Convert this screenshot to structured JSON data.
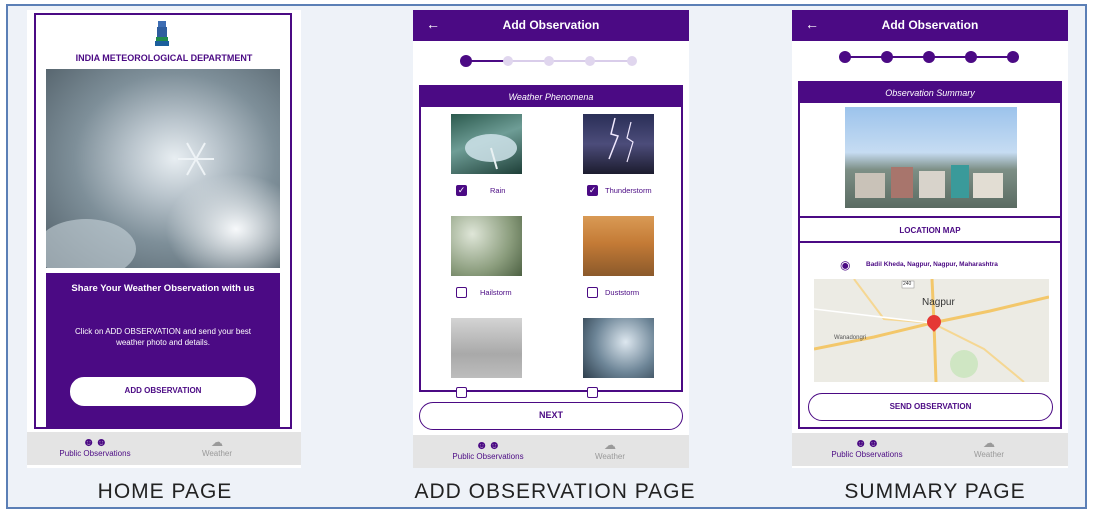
{
  "colors": {
    "brand_purple": "#4b0a84",
    "frame_border": "#5b7fb6",
    "nav_bg": "#e4e4e4"
  },
  "home": {
    "caption": "HOME PAGE",
    "logo_icon": "emblem-icon",
    "org_title": "INDIA METEOROLOGICAL DEPARTMENT",
    "heading": "Share Your Weather Observation with us",
    "body": "Click on ADD OBSERVATION and send your best weather photo and details.",
    "button": "ADD OBSERVATION"
  },
  "add": {
    "caption": "ADD OBSERVATION PAGE",
    "title": "Add Observation",
    "back_icon": "arrow-left-icon",
    "stepper": {
      "current": 1,
      "total": 5
    },
    "card_title": "Weather Phenomena",
    "items": [
      {
        "label": "Rain",
        "checked": true
      },
      {
        "label": "Thunderstorm",
        "checked": true
      },
      {
        "label": "Hailstorm",
        "checked": false
      },
      {
        "label": "Duststorm",
        "checked": false
      }
    ],
    "next_button": "NEXT"
  },
  "summary": {
    "caption": "SUMMARY PAGE",
    "title": "Add Observation",
    "back_icon": "arrow-left-icon",
    "stepper": {
      "current": 5,
      "total": 5
    },
    "card_title": "Observation Summary",
    "location_header": "LOCATION MAP",
    "address": "Badil Kheda, Nagpur, Nagpur, Maharashtra",
    "map_labels": {
      "city": "Nagpur",
      "area": "Wanadongri",
      "road": "240"
    },
    "send_button": "SEND OBSERVATION"
  },
  "nav": {
    "public": "Public Observations",
    "weather": "Weather",
    "public_icon": "people-icon",
    "weather_icon": "cloud-icon"
  }
}
